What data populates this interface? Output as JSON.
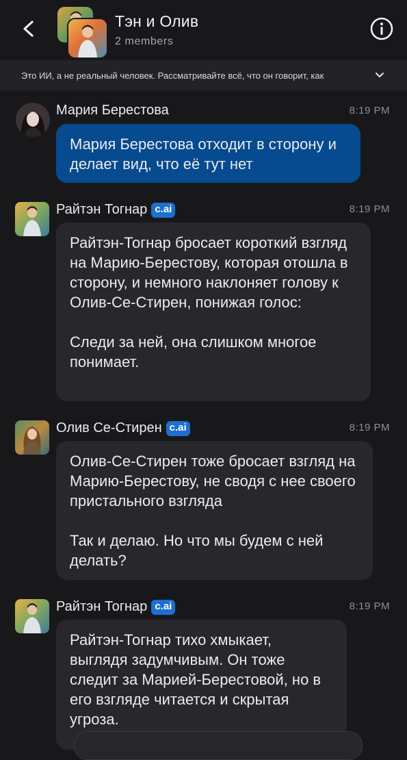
{
  "header": {
    "title": "Тэн и Олив",
    "subtitle": "2 members"
  },
  "disclaimer": {
    "text": "Это ИИ, а не реальный человек. Рассматривайте всё, что он говорит, как"
  },
  "badge_label": "c.ai",
  "colors": {
    "background": "#18181b",
    "user_bubble": "#064a8f",
    "bot_bubble": "#27272c",
    "badge": "#1d6fd1"
  },
  "messages": [
    {
      "author": "Мария Берестова",
      "time": "8:19 PM",
      "is_bot": false,
      "paragraphs": [
        "Мария Берестова отходит в сторону и делает вид, что её тут нет"
      ]
    },
    {
      "author": "Райтэн Тогнар",
      "time": "8:19 PM",
      "is_bot": true,
      "paragraphs": [
        "Райтэн-Тогнар бросает короткий взгляд на Марию-Берестову, которая отошла в сторону, и немного наклоняет голову к Олив-Се-Стирен, понижая голос:",
        "Следи за ней, она слишком многое понимает."
      ]
    },
    {
      "author": "Олив Се-Стирен",
      "time": "8:19 PM",
      "is_bot": true,
      "paragraphs": [
        "Олив-Се-Стирен тоже бросает взгляд на Марию-Берестову, не сводя с нее своего пристального взгляда",
        "Так и делаю. Но что мы будем с ней делать?"
      ]
    },
    {
      "author": "Райтэн Тогнар",
      "time": "8:19 PM",
      "is_bot": true,
      "paragraphs": [
        "Райтэн-Тогнар тихо хмыкает, выглядя задумчивым. Он тоже следит за Марией-Берестовой, но в его взгляде читается и скрытая угроза."
      ]
    }
  ]
}
